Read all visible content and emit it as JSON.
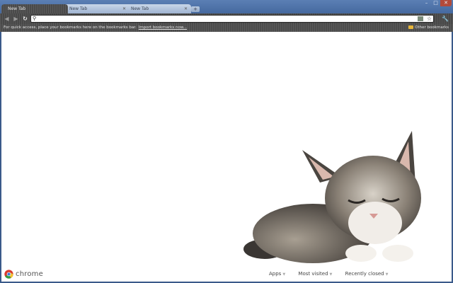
{
  "tabs": [
    {
      "title": "New Tab",
      "active": true
    },
    {
      "title": "New Tab",
      "active": false
    },
    {
      "title": "New Tab",
      "active": false
    }
  ],
  "window_controls": [
    "minimize",
    "maximize",
    "close"
  ],
  "toolbar": {
    "back_icon": "back-arrow-icon",
    "forward_icon": "forward-arrow-icon",
    "reload_icon": "reload-icon",
    "omnibox_value": "",
    "star_icon": "bookmark-star-icon",
    "wrench_icon": "wrench-icon"
  },
  "bookmarks_bar": {
    "message": "For quick access, place your bookmarks here on the bookmarks bar.",
    "import_link": "Import bookmarks now...",
    "other_bookmarks": "Other bookmarks"
  },
  "new_tab_page": {
    "background_image": "sleeping-kitten",
    "brand": "chrome",
    "footer_links": [
      {
        "label": "Apps"
      },
      {
        "label": "Most visited"
      },
      {
        "label": "Recently closed"
      }
    ]
  },
  "colors": {
    "frame": "#4a6ea3",
    "toolbar": "#505050",
    "page": "#ffffff"
  }
}
